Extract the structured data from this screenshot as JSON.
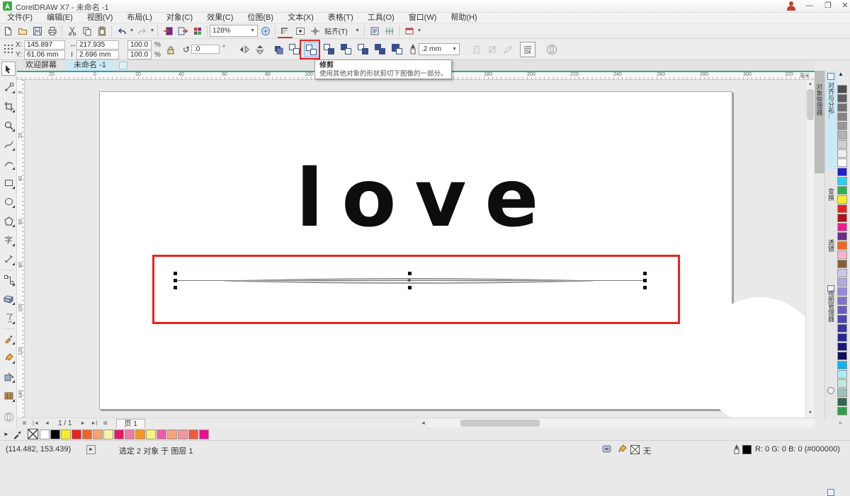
{
  "window": {
    "title": "CorelDRAW X7 - 未命名 -1"
  },
  "menu": {
    "items": [
      "文件(F)",
      "编辑(E)",
      "视图(V)",
      "布局(L)",
      "对象(C)",
      "效果(C)",
      "位图(B)",
      "文本(X)",
      "表格(T)",
      "工具(O)",
      "窗口(W)",
      "帮助(H)"
    ]
  },
  "toolbar": {
    "zoom_value": "128%",
    "snap_label": "贴齐(T)"
  },
  "property_bar": {
    "x_label": "X:",
    "x_value": "145.897 mm",
    "y_label": "Y:",
    "y_value": "61.06 mm",
    "width_value": "217.935 mm",
    "height_value": "2.696 mm",
    "scale_x": "100.0",
    "scale_y": "100.0",
    "percent": "%",
    "rotation_value": ".0",
    "degree": "°",
    "outline_width": ".2 mm"
  },
  "tooltip": {
    "title": "修剪",
    "description": "使用其他对象的形状剪切下图像的一部分。"
  },
  "doc_tabs": {
    "welcome": "欢迎屏幕",
    "untitled": "未命名 -1"
  },
  "ruler": {
    "unit": "毫米",
    "h_labels": [
      "20",
      "0",
      "20",
      "40",
      "60",
      "80",
      "100",
      "180",
      "200",
      "220",
      "240",
      "260",
      "280",
      "300",
      "320"
    ],
    "v_labels": [
      "0",
      "20",
      "40",
      "60",
      "80",
      "100",
      "120",
      "140"
    ]
  },
  "canvas": {
    "text": "love"
  },
  "dockers": {
    "object_manager": "对象管理器",
    "tabs": [
      "对齐与分布...",
      "变换",
      "透镜",
      "视图管理器"
    ]
  },
  "palettes": {
    "right": [
      "#4e4e4e",
      "#606060",
      "#727272",
      "#848484",
      "#969696",
      "#b2b2b2",
      "#d0d0d0",
      "#ededed",
      "#ffffff",
      "#2020c8",
      "#2bd0f0",
      "#28b44b",
      "#fced22",
      "#e8231d",
      "#b01016",
      "#ea1c8e",
      "#6a2d90",
      "#f06522",
      "#f9b5cf",
      "#8a5d3b",
      "#cfc6ec",
      "#b2a8e2",
      "#968cd6",
      "#7d74ca",
      "#655cbe",
      "#4c46b2",
      "#3835a5",
      "#272795",
      "#1a1a7e",
      "#0f0f60",
      "#12b2ee",
      "#aeeaf8",
      "#c6e6df",
      "#9dc2b8",
      "#2f6a52",
      "#2f9f47"
    ],
    "bottom_no_color": "X",
    "bottom": [
      "#ffffff",
      "#000000",
      "#fced22",
      "#e8231d",
      "#f06522",
      "#f9a26b",
      "#faf3a0",
      "#e81766",
      "#f27ba0",
      "#f7941d",
      "#fdf07e",
      "#f25bad",
      "#f7a278",
      "#f593a0",
      "#f1583d",
      "#ec0f8f"
    ]
  },
  "page_nav": {
    "pages": "1 / 1",
    "page_tab": "页 1"
  },
  "status": {
    "coords": "(114.482, 153.439)",
    "selection": "选定 2 对象 于 图层 1",
    "fill_none": "无",
    "outline_rgb": "R: 0 G: 0 B: 0 (#000000)"
  },
  "colors": {
    "accent_teal": "#29a8a4",
    "annotation_red": "#e8231d",
    "highlight_blue": "#cfe4f7",
    "selection_black": "#111111"
  }
}
